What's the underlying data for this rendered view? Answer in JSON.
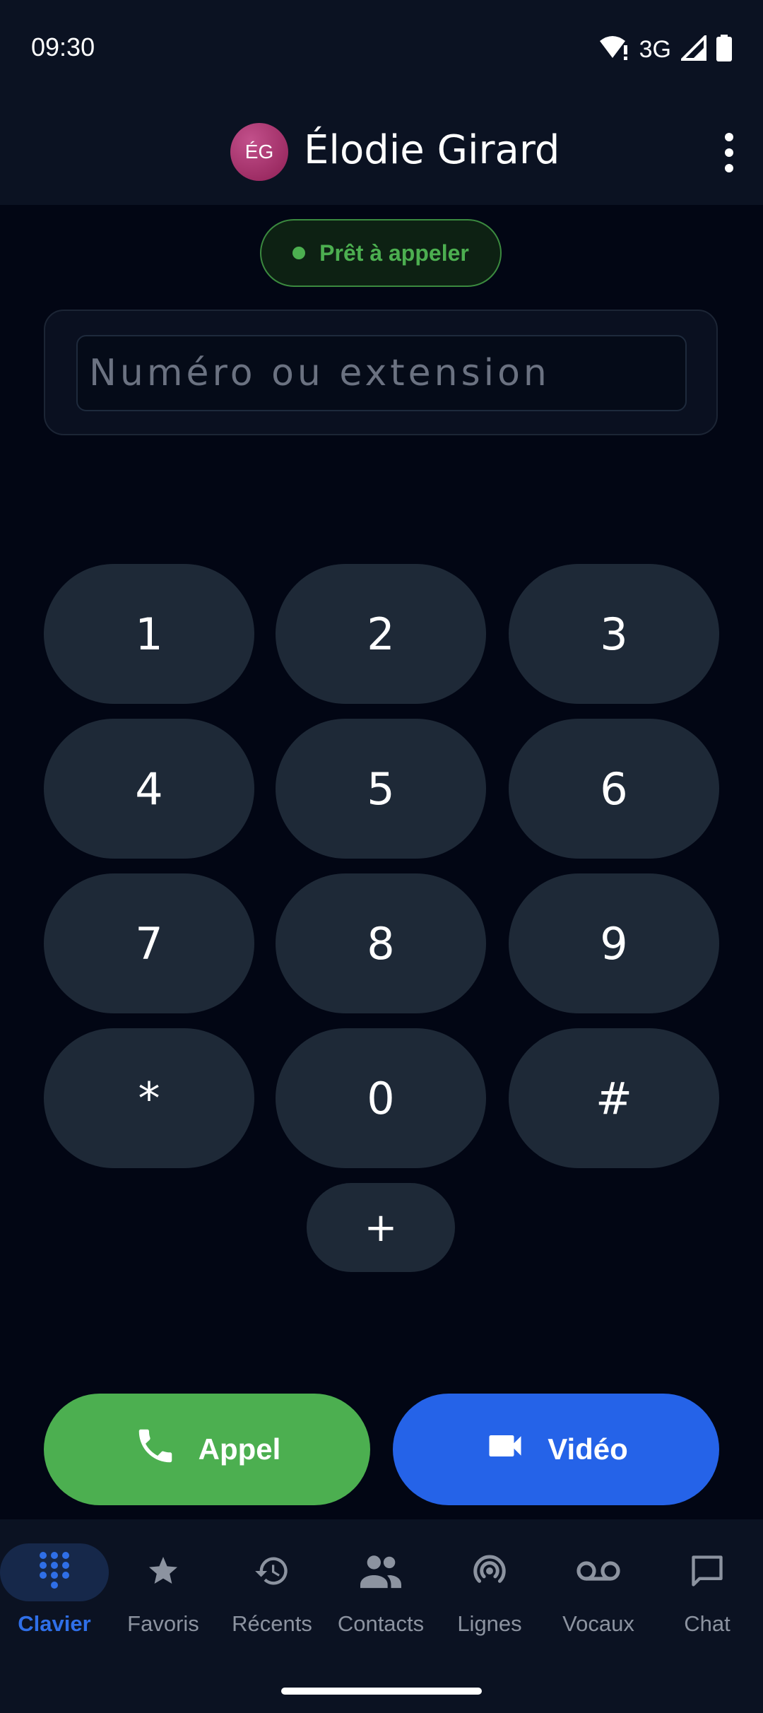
{
  "status_bar": {
    "time": "09:30",
    "network": "3G",
    "icons": [
      "wifi-alert-icon",
      "signal-icon",
      "battery-icon"
    ]
  },
  "app_bar": {
    "avatar_initials": "ÉG",
    "title": "Élodie Girard",
    "menu_icon": "more-vert-icon"
  },
  "status_pill": {
    "label": "Prêt à appeler",
    "color": "#4caf50"
  },
  "input": {
    "placeholder": "Numéro ou extension",
    "value": ""
  },
  "keypad": {
    "keys": [
      "1",
      "2",
      "3",
      "4",
      "5",
      "6",
      "7",
      "8",
      "9",
      "*",
      "0",
      "#"
    ],
    "plus": "+"
  },
  "actions": {
    "call_label": "Appel",
    "call_color": "#4caf50",
    "video_label": "Vidéo",
    "video_color": "#2563e8"
  },
  "bottom_nav": {
    "items": [
      {
        "label": "Clavier",
        "icon": "dialpad-icon",
        "active": true
      },
      {
        "label": "Favoris",
        "icon": "star-icon",
        "active": false
      },
      {
        "label": "Récents",
        "icon": "history-icon",
        "active": false
      },
      {
        "label": "Contacts",
        "icon": "people-icon",
        "active": false
      },
      {
        "label": "Lignes",
        "icon": "broadcast-icon",
        "active": false
      },
      {
        "label": "Vocaux",
        "icon": "voicemail-icon",
        "active": false
      },
      {
        "label": "Chat",
        "icon": "chat-icon",
        "active": false
      }
    ]
  }
}
